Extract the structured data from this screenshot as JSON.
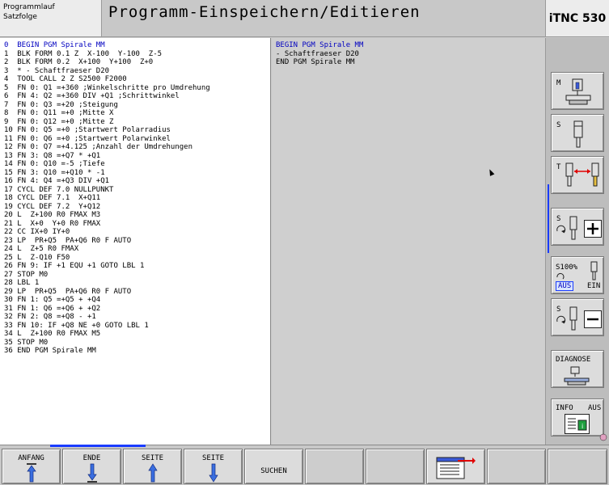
{
  "mode": {
    "line1": "Programmlauf",
    "line2": "Satzfolge"
  },
  "title": "Programm-Einspeichern/Editieren",
  "brand": "iTNC 530",
  "program_lines": [
    "0  BEGIN PGM Spirale MM",
    "1  BLK FORM 0.1 Z  X-100  Y-100  Z-5",
    "2  BLK FORM 0.2  X+100  Y+100  Z+0",
    "3  * - Schaftfraeser D20",
    "4  TOOL CALL 2 Z S2500 F2000",
    "5  FN 0: Q1 =+360 ;Winkelschritte pro Umdrehung",
    "6  FN 4: Q2 =+360 DIV +Q1 ;Schrittwinkel",
    "7  FN 0: Q3 =+20 ;Steigung",
    "8  FN 0: Q11 =+0 ;Mitte X",
    "9  FN 0: Q12 =+0 ;Mitte Z",
    "10 FN 0: Q5 =+0 ;Startwert Polarradius",
    "11 FN 0: Q6 =+0 ;Startwert Polarwinkel",
    "12 FN 0: Q7 =+4.125 ;Anzahl der Umdrehungen",
    "13 FN 3: Q8 =+Q7 * +Q1",
    "14 FN 0: Q10 =-5 ;Tiefe",
    "15 FN 3: Q10 =+Q10 * -1",
    "16 FN 4: Q4 =+Q3 DIV +Q1",
    "17 CYCL DEF 7.0 NULLPUNKT",
    "18 CYCL DEF 7.1  X+Q11",
    "19 CYCL DEF 7.2  Y+Q12",
    "20 L  Z+100 R0 FMAX M3",
    "21 L  X+0  Y+0 R0 FMAX",
    "22 CC IX+0 IY+0",
    "23 LP  PR+Q5  PA+Q6 R0 F AUTO",
    "24 L  Z+5 R0 FMAX",
    "25 L  Z-Q10 F50",
    "26 FN 9: IF +1 EQU +1 GOTO LBL 1",
    "27 STOP M0",
    "28 LBL 1",
    "29 LP  PR+Q5  PA+Q6 R0 F AUTO",
    "30 FN 1: Q5 =+Q5 + +Q4",
    "31 FN 1: Q6 =+Q6 + +Q2",
    "32 FN 2: Q8 =+Q8 - +1",
    "33 FN 10: IF +Q8 NE +0 GOTO LBL 1",
    "34 L  Z+100 R0 FMAX M5",
    "35 STOP M0",
    "36 END PGM Spirale MM"
  ],
  "preview_lines": [
    "BEGIN PGM Spirale MM",
    "- Schaftfraeser D20",
    "END PGM Spirale MM"
  ],
  "softkeys_right": {
    "m": "M",
    "s": "S",
    "t": "T",
    "s_plus": "S",
    "s_pct": "S100%",
    "aus": "AUS",
    "ein": "EIN",
    "s_minus": "S",
    "diagnose": "DIAGNOSE",
    "info": "INFO",
    "info_aus": "AUS"
  },
  "softkeys_bottom": {
    "anfang": "ANFANG",
    "ende": "ENDE",
    "seite_up": "SEITE",
    "seite_down": "SEITE",
    "suchen": "SUCHEN"
  },
  "colors": {
    "active_text": "#0000c0",
    "accent_blue": "#1a3cff"
  }
}
